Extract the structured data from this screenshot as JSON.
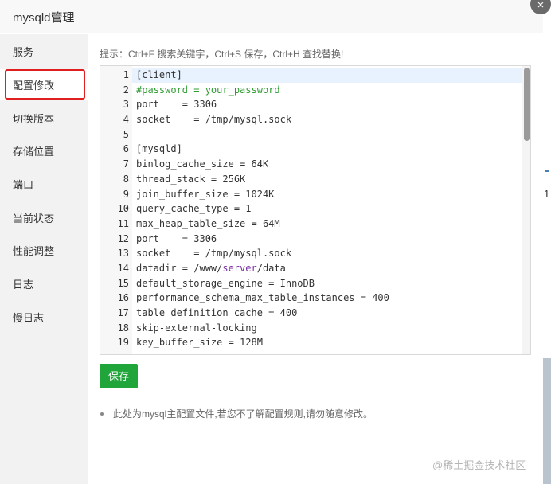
{
  "dialog": {
    "title": "mysqld管理",
    "close_icon": "×"
  },
  "sidebar": {
    "items": [
      {
        "label": "服务"
      },
      {
        "label": "配置修改",
        "active": true
      },
      {
        "label": "切换版本"
      },
      {
        "label": "存储位置"
      },
      {
        "label": "端口"
      },
      {
        "label": "当前状态"
      },
      {
        "label": "性能调整"
      },
      {
        "label": "日志"
      },
      {
        "label": "慢日志"
      }
    ]
  },
  "main": {
    "hint": "提示：Ctrl+F 搜索关键字，Ctrl+S 保存，Ctrl+H 查找替换!",
    "save_label": "保存",
    "note": "此处为mysql主配置文件,若您不了解配置规则,请勿随意修改。"
  },
  "editor": {
    "lines": [
      {
        "n": "1",
        "text": "[client]"
      },
      {
        "n": "2",
        "text": "#password = your_password",
        "style": "comment"
      },
      {
        "n": "3",
        "text": "port    = 3306"
      },
      {
        "n": "4",
        "text": "socket    = /tmp/mysql.sock"
      },
      {
        "n": "5",
        "text": ""
      },
      {
        "n": "6",
        "text": "[mysqld]"
      },
      {
        "n": "7",
        "text": "binlog_cache_size = 64K"
      },
      {
        "n": "8",
        "text": "thread_stack = 256K"
      },
      {
        "n": "9",
        "text": "join_buffer_size = 1024K"
      },
      {
        "n": "10",
        "text": "query_cache_type = 1"
      },
      {
        "n": "11",
        "text": "max_heap_table_size = 64M"
      },
      {
        "n": "12",
        "text": "port    = 3306"
      },
      {
        "n": "13",
        "text": "socket    = /tmp/mysql.sock"
      },
      {
        "n": "14",
        "text_a": "datadir = /www/",
        "text_kw": "server",
        "text_b": "/data"
      },
      {
        "n": "15",
        "text": "default_storage_engine = InnoDB"
      },
      {
        "n": "16",
        "text": "performance_schema_max_table_instances = 400"
      },
      {
        "n": "17",
        "text": "table_definition_cache = 400"
      },
      {
        "n": "18",
        "text": "skip-external-locking"
      },
      {
        "n": "19",
        "text": "key_buffer_size = 128M"
      }
    ]
  },
  "background": {
    "digit": "1"
  },
  "watermark": "@稀土掘金技术社区",
  "colors": {
    "accent_green": "#20a53a",
    "highlight_red": "#e02020",
    "comment_green": "#2e9c31",
    "keyword_purple": "#7a2ea3"
  }
}
